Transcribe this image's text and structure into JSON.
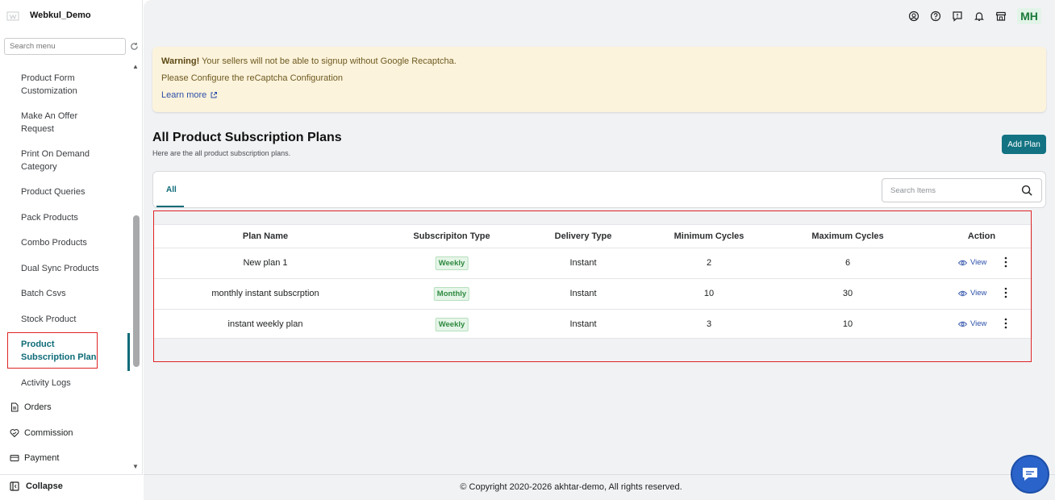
{
  "brand": {
    "name": "Webkul_Demo"
  },
  "sidebar": {
    "search_placeholder": "Search menu",
    "items": [
      {
        "label": "Product Form\nCustomization"
      },
      {
        "label": "Make An Offer\nRequest"
      },
      {
        "label": "Print On Demand\nCategory"
      },
      {
        "label": "Product Queries"
      },
      {
        "label": "Pack Products"
      },
      {
        "label": "Combo Products"
      },
      {
        "label": "Dual Sync Products"
      },
      {
        "label": "Batch Csvs"
      },
      {
        "label": "Stock Product"
      },
      {
        "label": "Product\nSubscription Plan",
        "active": true
      },
      {
        "label": "Activity Logs"
      }
    ],
    "top_items": [
      {
        "label": "Orders",
        "icon": "file-icon"
      },
      {
        "label": "Commission",
        "icon": "commission-icon"
      },
      {
        "label": "Payment",
        "icon": "card-icon"
      }
    ],
    "collapse_label": "Collapse"
  },
  "header": {
    "avatar": "MH"
  },
  "warning": {
    "strong": "Warning!",
    "message": " Your sellers will not be able to signup without Google Recaptcha.",
    "line2": "Please Configure the reCaptcha Configuration",
    "link": "Learn more"
  },
  "page": {
    "title": "All Product Subscription Plans",
    "subtitle": "Here are the all product subscription plans.",
    "add_button": "Add Plan",
    "tab_all": "All",
    "search_placeholder": "Search Items"
  },
  "table": {
    "columns": [
      "Plan Name",
      "Subscripiton Type",
      "Delivery Type",
      "Minimum Cycles",
      "Maximum Cycles",
      "Action"
    ],
    "rows": [
      {
        "name": "New plan 1",
        "type": "Weekly",
        "delivery": "Instant",
        "min": "2",
        "max": "6",
        "action": "View"
      },
      {
        "name": "monthly instant subscrption",
        "type": "Monthly",
        "delivery": "Instant",
        "min": "10",
        "max": "30",
        "action": "View"
      },
      {
        "name": "instant weekly plan",
        "type": "Weekly",
        "delivery": "Instant",
        "min": "3",
        "max": "10",
        "action": "View"
      }
    ]
  },
  "footer": {
    "text": "© Copyright 2020-2026 akhtar-demo, All rights reserved."
  },
  "colors": {
    "accent": "#137382",
    "highlight": "#e02424",
    "chat": "#2a63c9"
  }
}
